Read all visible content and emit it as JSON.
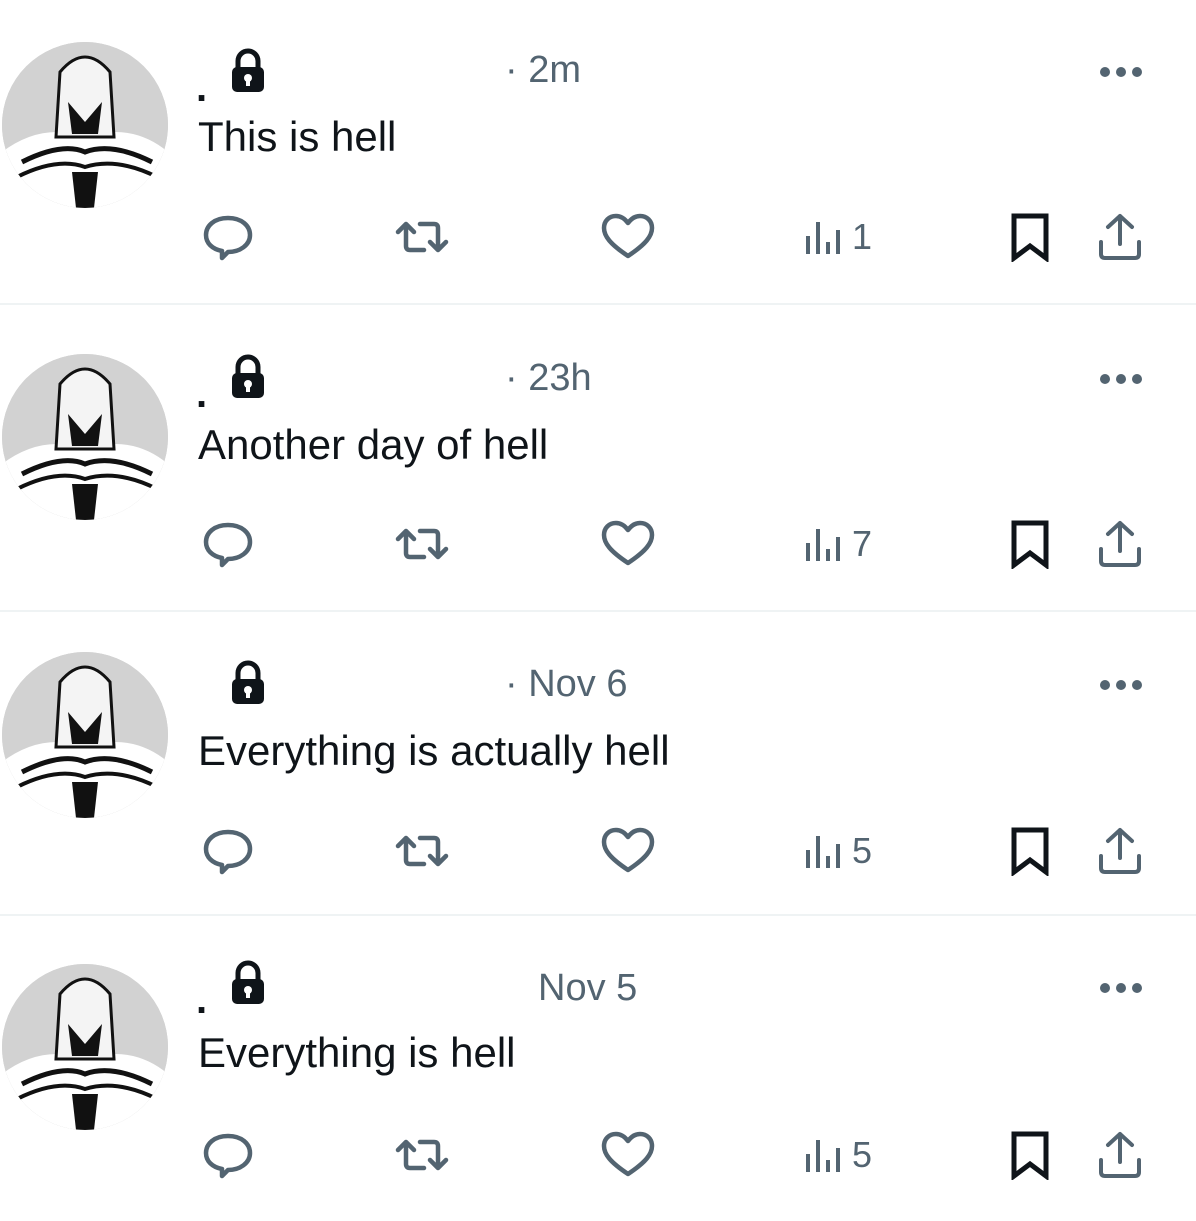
{
  "feed": {
    "tweets": [
      {
        "display_name": ".",
        "time": "· 2m",
        "text": "This is hell",
        "views": "1"
      },
      {
        "display_name": ".",
        "time": "· 23h",
        "text": "Another day of hell",
        "views": "7"
      },
      {
        "display_name": "",
        "time": "· Nov 6",
        "text": "Everything is actually hell",
        "views": "5"
      },
      {
        "display_name": ".",
        "time": "Nov 5",
        "text": "Everything is hell",
        "views": "5"
      }
    ]
  },
  "icons": {
    "protected": "lock-icon",
    "more": "more-icon",
    "reply": "reply-icon",
    "retweet": "retweet-icon",
    "like": "heart-icon",
    "views": "analytics-icon",
    "bookmark": "bookmark-icon",
    "share": "share-icon"
  },
  "colors": {
    "secondary_text": "#536471",
    "primary_text": "#0f1419",
    "divider": "#eff3f4"
  }
}
